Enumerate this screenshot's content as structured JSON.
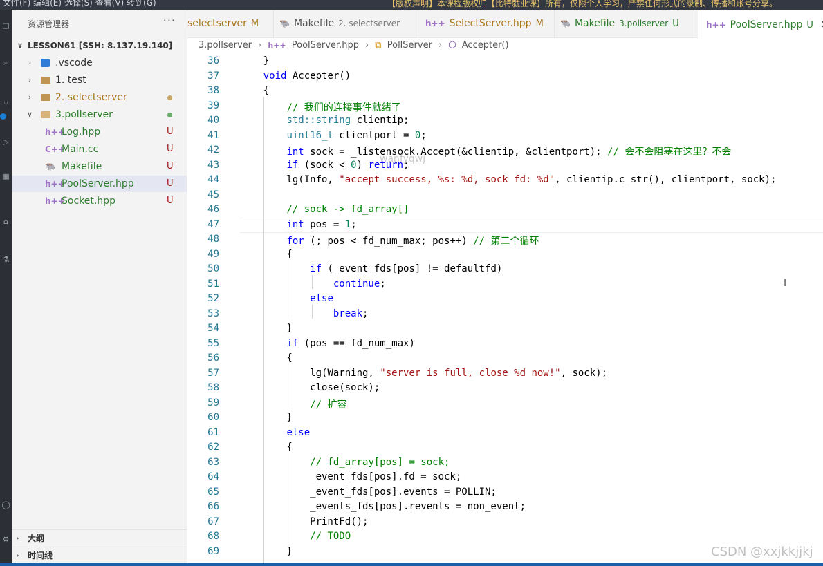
{
  "banner": {
    "menu": "文件(F)   编辑(E)   选择(S)   查看(V)   转到(G)",
    "notice": "【版权声明】本课程版权归【比特就业课】所有，仅限个人学习，严禁任何形式的录制、传播和账号分享。"
  },
  "activity_icons": [
    "explorer-icon",
    "search-icon",
    "source-control-icon",
    "run-debug-icon",
    "extensions-icon",
    "remote-icon",
    "account-icon"
  ],
  "sidebar": {
    "title": "资源管理器",
    "more": "···",
    "root": "LESSON61 [SSH: 8.137.19.140]",
    "items": [
      {
        "label": ".vscode",
        "kind": "folder-vscode",
        "chevron": ">",
        "status": ""
      },
      {
        "label": "1. test",
        "kind": "folder",
        "chevron": ">",
        "status": ""
      },
      {
        "label": "2. selectserver",
        "kind": "folder",
        "chevron": ">",
        "status": "dot"
      },
      {
        "label": "3.pollserver",
        "kind": "folder-open",
        "chevron": "v",
        "status": "dot"
      },
      {
        "label": "Log.hpp",
        "kind": "hpp",
        "icon": "h++",
        "status": "U"
      },
      {
        "label": "Main.cc",
        "kind": "cpp",
        "icon": "C++",
        "status": "U"
      },
      {
        "label": "Makefile",
        "kind": "makefile",
        "icon": "🐃",
        "status": "U"
      },
      {
        "label": "PoolServer.hpp",
        "kind": "hpp",
        "icon": "h++",
        "status": "U"
      },
      {
        "label": "Socket.hpp",
        "kind": "hpp",
        "icon": "h++",
        "status": "U"
      }
    ],
    "outline": "大纲",
    "timeline": "时间线"
  },
  "tabs": [
    {
      "name": "selectserver",
      "desc": "",
      "status": "M",
      "icon": "",
      "active": false
    },
    {
      "name": "Makefile",
      "desc": "2. selectserver",
      "status": "",
      "icon": "🐃",
      "active": false
    },
    {
      "name": "SelectServer.hpp",
      "desc": "",
      "status": "M",
      "icon": "h++",
      "active": false
    },
    {
      "name": "Makefile",
      "desc": "3.pollserver",
      "status": "U",
      "icon": "🐃",
      "active": false
    },
    {
      "name": "PoolServer.hpp",
      "desc": "",
      "status": "U",
      "icon": "h++",
      "active": true,
      "close": "×"
    }
  ],
  "breadcrumb": {
    "folder": "3.pollserver",
    "file": "PoolServer.hpp",
    "cls": "PollServer",
    "method": "Accepter()"
  },
  "editor": {
    "watermark": "wanfyqwj",
    "csdn": "CSDN @xxjkkjjkj",
    "lines": [
      {
        "n": "36",
        "t": "    }"
      },
      {
        "n": "37",
        "t": "    void Accepter()"
      },
      {
        "n": "38",
        "t": "    {"
      },
      {
        "n": "39",
        "t": "        // 我们的连接事件就绪了"
      },
      {
        "n": "40",
        "t": "        std::string clientip;"
      },
      {
        "n": "41",
        "t": "        uint16_t clientport = 0;"
      },
      {
        "n": "42",
        "t": "        int sock = _listensock.Accept(&clientip, &clientport); // 会不会阻塞在这里？不会"
      },
      {
        "n": "43",
        "t": "        if (sock < 0) return;"
      },
      {
        "n": "44",
        "t": "        lg(Info, \"accept success, %s: %d, sock fd: %d\", clientip.c_str(), clientport, sock);"
      },
      {
        "n": "45",
        "t": ""
      },
      {
        "n": "46",
        "t": "        // sock -> fd_array[]"
      },
      {
        "n": "47",
        "t": "        int pos = 1;"
      },
      {
        "n": "48",
        "t": "        for (; pos < fd_num_max; pos++) // 第二个循环"
      },
      {
        "n": "49",
        "t": "        {"
      },
      {
        "n": "50",
        "t": "            if (_event_fds[pos] != defaultfd)"
      },
      {
        "n": "51",
        "t": "                continue;"
      },
      {
        "n": "52",
        "t": "            else"
      },
      {
        "n": "53",
        "t": "                break;"
      },
      {
        "n": "54",
        "t": "        }"
      },
      {
        "n": "55",
        "t": "        if (pos == fd_num_max)"
      },
      {
        "n": "56",
        "t": "        {"
      },
      {
        "n": "57",
        "t": "            lg(Warning, \"server is full, close %d now!\", sock);"
      },
      {
        "n": "58",
        "t": "            close(sock);"
      },
      {
        "n": "59",
        "t": "            // 扩容"
      },
      {
        "n": "60",
        "t": "        }"
      },
      {
        "n": "61",
        "t": "        else"
      },
      {
        "n": "62",
        "t": "        {"
      },
      {
        "n": "63",
        "t": "            // fd_array[pos] = sock;"
      },
      {
        "n": "64",
        "t": "            _event_fds[pos].fd = sock;"
      },
      {
        "n": "65",
        "t": "            _event_fds[pos].events = POLLIN;"
      },
      {
        "n": "66",
        "t": "            _events_fds[pos].revents = non_event;"
      },
      {
        "n": "67",
        "t": "            PrintFd();"
      },
      {
        "n": "68",
        "t": "            // TODO"
      },
      {
        "n": "69",
        "t": "        }"
      }
    ]
  },
  "colors": {
    "accent": "#1a7fd6",
    "modified": "#b98a24",
    "untracked": "#3a8a3a",
    "line_number": "#237893"
  }
}
